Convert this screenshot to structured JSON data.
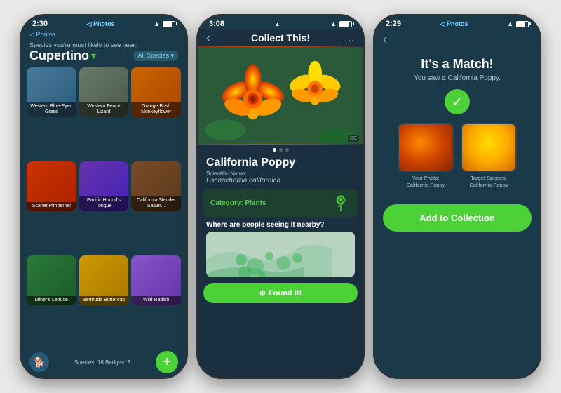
{
  "phone1": {
    "statusBar": {
      "time": "2:30",
      "nav": "◁ Photos"
    },
    "speciesLabel": "Species you're most likely to see near:",
    "location": "Cupertino",
    "locationIcon": "▾",
    "allSpecies": "All Species ▾",
    "species": [
      {
        "name": "Western Blue-Eyed Grass",
        "colorClass": "thumb-blue"
      },
      {
        "name": "Western Fence Lizard",
        "colorClass": "thumb-gray"
      },
      {
        "name": "Orange Bush Monkeyflower",
        "colorClass": "thumb-orange"
      },
      {
        "name": "Scarlet Pimpernel",
        "colorClass": "thumb-red"
      },
      {
        "name": "Pacific Hound's Tongue",
        "colorClass": "thumb-purple"
      },
      {
        "name": "California Slender Salam...",
        "colorClass": "thumb-brown"
      },
      {
        "name": "Miner's Lettuce",
        "colorClass": "thumb-green"
      },
      {
        "name": "Bermuda Buttercup",
        "colorClass": "thumb-yellow"
      },
      {
        "name": "Wild Radish",
        "colorClass": "thumb-lightpurple"
      }
    ],
    "stats": "Species: 16   Badges: 8",
    "fabLabel": "+"
  },
  "phone2": {
    "statusBar": {
      "time": "3:08",
      "nav": "..."
    },
    "title": "Collect This!",
    "backLabel": "‹",
    "commonName": "California Poppy",
    "sciLabel": "Scientific Name:",
    "sciName": "Eschscholzia californica",
    "categoryLabel": "Category: Plants",
    "nearbyTitle": "Where are people seeing it nearby?",
    "foundItLabel": "Found It!",
    "ccLabel": "CC"
  },
  "phone3": {
    "statusBar": {
      "time": "2:29",
      "nav": "◁ Photos"
    },
    "backLabel": "‹",
    "matchTitle": "It's a Match!",
    "matchSubtitle": "You saw a California Poppy.",
    "checkMark": "✓",
    "photos": [
      {
        "label": "Your Photo:\nCalifornia Poppy",
        "colorClass": "thumb-orange"
      },
      {
        "label": "Target Species:\nCalifornia Poppy",
        "colorClass": "thumb-yellow"
      }
    ],
    "addCollectionLabel": "Add to Collection"
  }
}
